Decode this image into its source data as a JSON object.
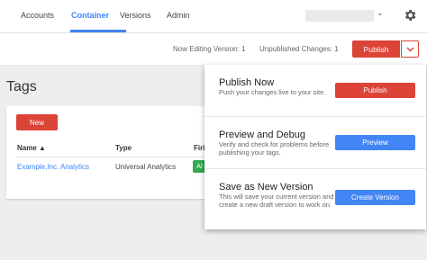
{
  "nav": {
    "tabs": [
      {
        "label": "Accounts"
      },
      {
        "label": "Container"
      },
      {
        "label": "Versions"
      },
      {
        "label": "Admin"
      }
    ],
    "account_chevron": "⌄"
  },
  "toolbar": {
    "editing_version": "Now Editing Version: 1",
    "unpublished_changes": "Unpublished Changes: 1",
    "publish_label": "Publish"
  },
  "tags_page": {
    "title": "Tags",
    "new_label": "New",
    "columns": [
      "Name ▲",
      "Type",
      "Firi"
    ],
    "rows": [
      {
        "name": "Example,Inc. Analytics",
        "type": "Universal Analytics",
        "firing": "Al"
      }
    ]
  },
  "publish_menu": {
    "options": [
      {
        "title": "Publish Now",
        "desc": "Push your changes live to your site.",
        "button": "Publish"
      },
      {
        "title": "Preview and Debug",
        "desc": "Verify and check for problems before publishing your tags.",
        "button": "Preview"
      },
      {
        "title": "Save as New Version",
        "desc": "This will save your current version and create a new draft version to work on.",
        "button": "Create Version"
      }
    ]
  },
  "colors": {
    "accent_blue": "#4285f4",
    "publish_red": "#db4437",
    "firing_green": "#34a853"
  },
  "icons": {
    "settings": "gear-icon",
    "dropdown": "chevron-down-icon"
  }
}
